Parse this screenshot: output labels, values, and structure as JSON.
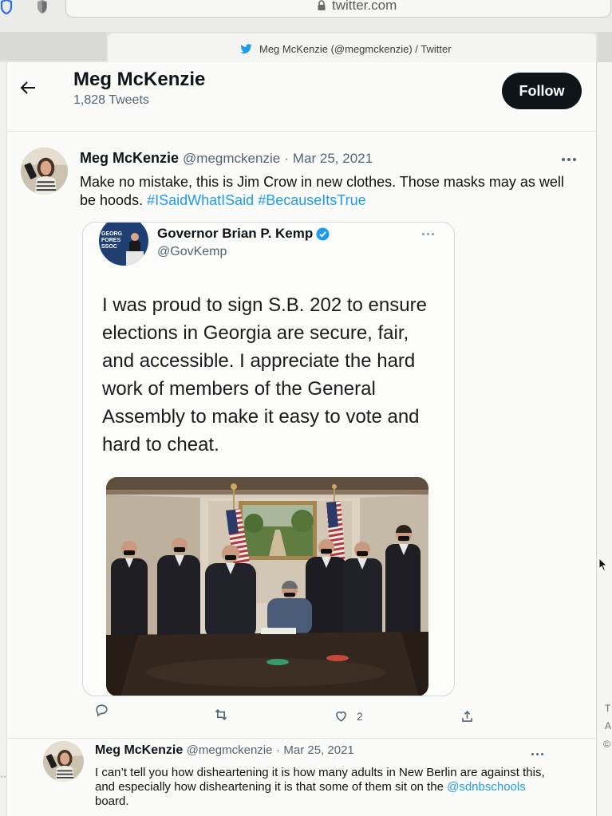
{
  "browser": {
    "url": "twitter.com",
    "tab_title": "Meg McKenzie (@megmckenzie) / Twitter"
  },
  "profile_header": {
    "name": "Meg McKenzie",
    "tweet_count": "1,828 Tweets",
    "follow_label": "Follow"
  },
  "tweets": [
    {
      "name": "Meg McKenzie",
      "handle": "@megmckenzie",
      "separator": "·",
      "date": "Mar 25, 2021",
      "text": "Make no mistake, this is Jim Crow in new clothes. Those masks may as well be hoods.",
      "hashtags": [
        "#ISaidWhatISaid",
        "#BecauseItsTrue"
      ],
      "quoted_tweet": {
        "name": "Governor Brian P. Kemp",
        "handle": "@GovKemp",
        "verified": true,
        "avatar_logo_text": [
          "GEORG",
          "FORES",
          "SSOC"
        ],
        "text_lines": [
          "I was proud to sign S.B. 202 to ensure",
          "elections in Georgia are secure, fair,",
          "and accessible. I appreciate the hard",
          "work of members of the General",
          "Assembly to make it easy to vote and",
          "hard to cheat."
        ]
      },
      "actions": {
        "like_count": "2"
      }
    },
    {
      "name": "Meg McKenzie",
      "handle": "@megmckenzie",
      "separator": "·",
      "date": "Mar 25, 2021",
      "text_before": "I can’t tell you how disheartening it is how many adults in New Berlin are against this, and especially how disheartening it is that some of them sit on the",
      "mention": "@sdnbschools",
      "text_after": "board."
    }
  ],
  "right_sidebar_fragments": [
    "T",
    "A",
    "©"
  ],
  "left_sidebar_fragment": "··",
  "colors": {
    "accent": "#1d9bf0",
    "text": "#0f1419",
    "secondary": "#536471",
    "follow_button": "#0f1419",
    "border": "#cfd9de"
  },
  "icons": {
    "back": "arrow-left-icon",
    "lock": "lock-icon",
    "tab": "twitter-bird-icon",
    "verified": "verified-badge-icon",
    "more": "more-icon",
    "reply": "reply-icon",
    "retweet": "retweet-icon",
    "like": "heart-icon",
    "share": "share-icon",
    "cursor": "mouse-cursor-icon"
  }
}
